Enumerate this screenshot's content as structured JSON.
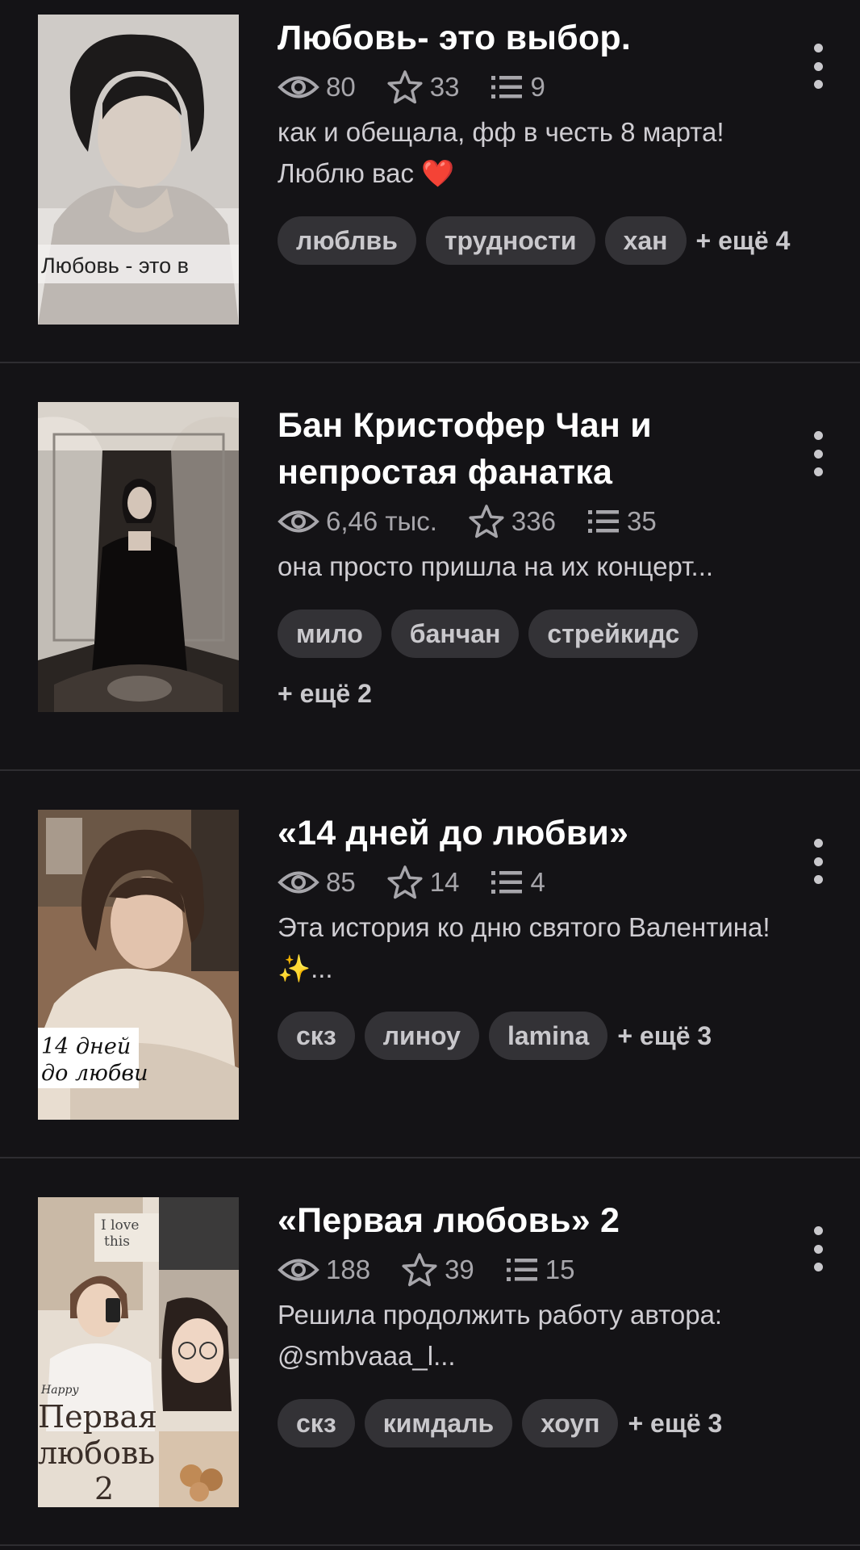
{
  "stories": [
    {
      "title": "Любовь- это выбор.",
      "views": "80",
      "stars": "33",
      "chapters": "9",
      "description": "как и обещала, фф в честь 8 марта! Люблю вас ❤️",
      "tags": [
        "люблвь",
        "трудности",
        "хан"
      ],
      "more_tags": "+ ещё 4",
      "cover_caption": "Любовь - это в"
    },
    {
      "title": "Бан Кристофер Чан и непростая фанатка",
      "views": "6,46 тыс.",
      "stars": "336",
      "chapters": "35",
      "description": "она просто пришла на их концерт...",
      "tags": [
        "мило",
        "банчан",
        "стрейкидс"
      ],
      "more_tags": "+ ещё 2"
    },
    {
      "title": "«14 дней до любви»",
      "views": "85",
      "stars": "14",
      "chapters": "4",
      "description": "Эта история ко дню святого Валентина! ✨...",
      "tags": [
        "скз",
        "линоу",
        "lamina"
      ],
      "more_tags": "+ ещё 3",
      "cover_caption_line1": "14 дней",
      "cover_caption_line2": "до любви"
    },
    {
      "title": "«Первая любовь» 2",
      "views": "188",
      "stars": "39",
      "chapters": "15",
      "description": "Решила продолжить работу автора: @smbvaaa_l...",
      "tags": [
        "скз",
        "кимдаль",
        "хоуп"
      ],
      "more_tags": "+ ещё 3",
      "cover_caption_small": "Happy",
      "cover_caption_line1": "Первая",
      "cover_caption_line2": "любовь",
      "cover_caption_line3": "2",
      "cover_note_line1": "I love",
      "cover_note_line2": "this"
    }
  ],
  "colors": {
    "background": "#141316",
    "tag_bg": "#333236",
    "meta_text": "#a7a6ab",
    "divider": "#2e2d31"
  },
  "icons": [
    "eye-icon",
    "star-icon",
    "chapters-list-icon",
    "more-vertical-icon"
  ]
}
